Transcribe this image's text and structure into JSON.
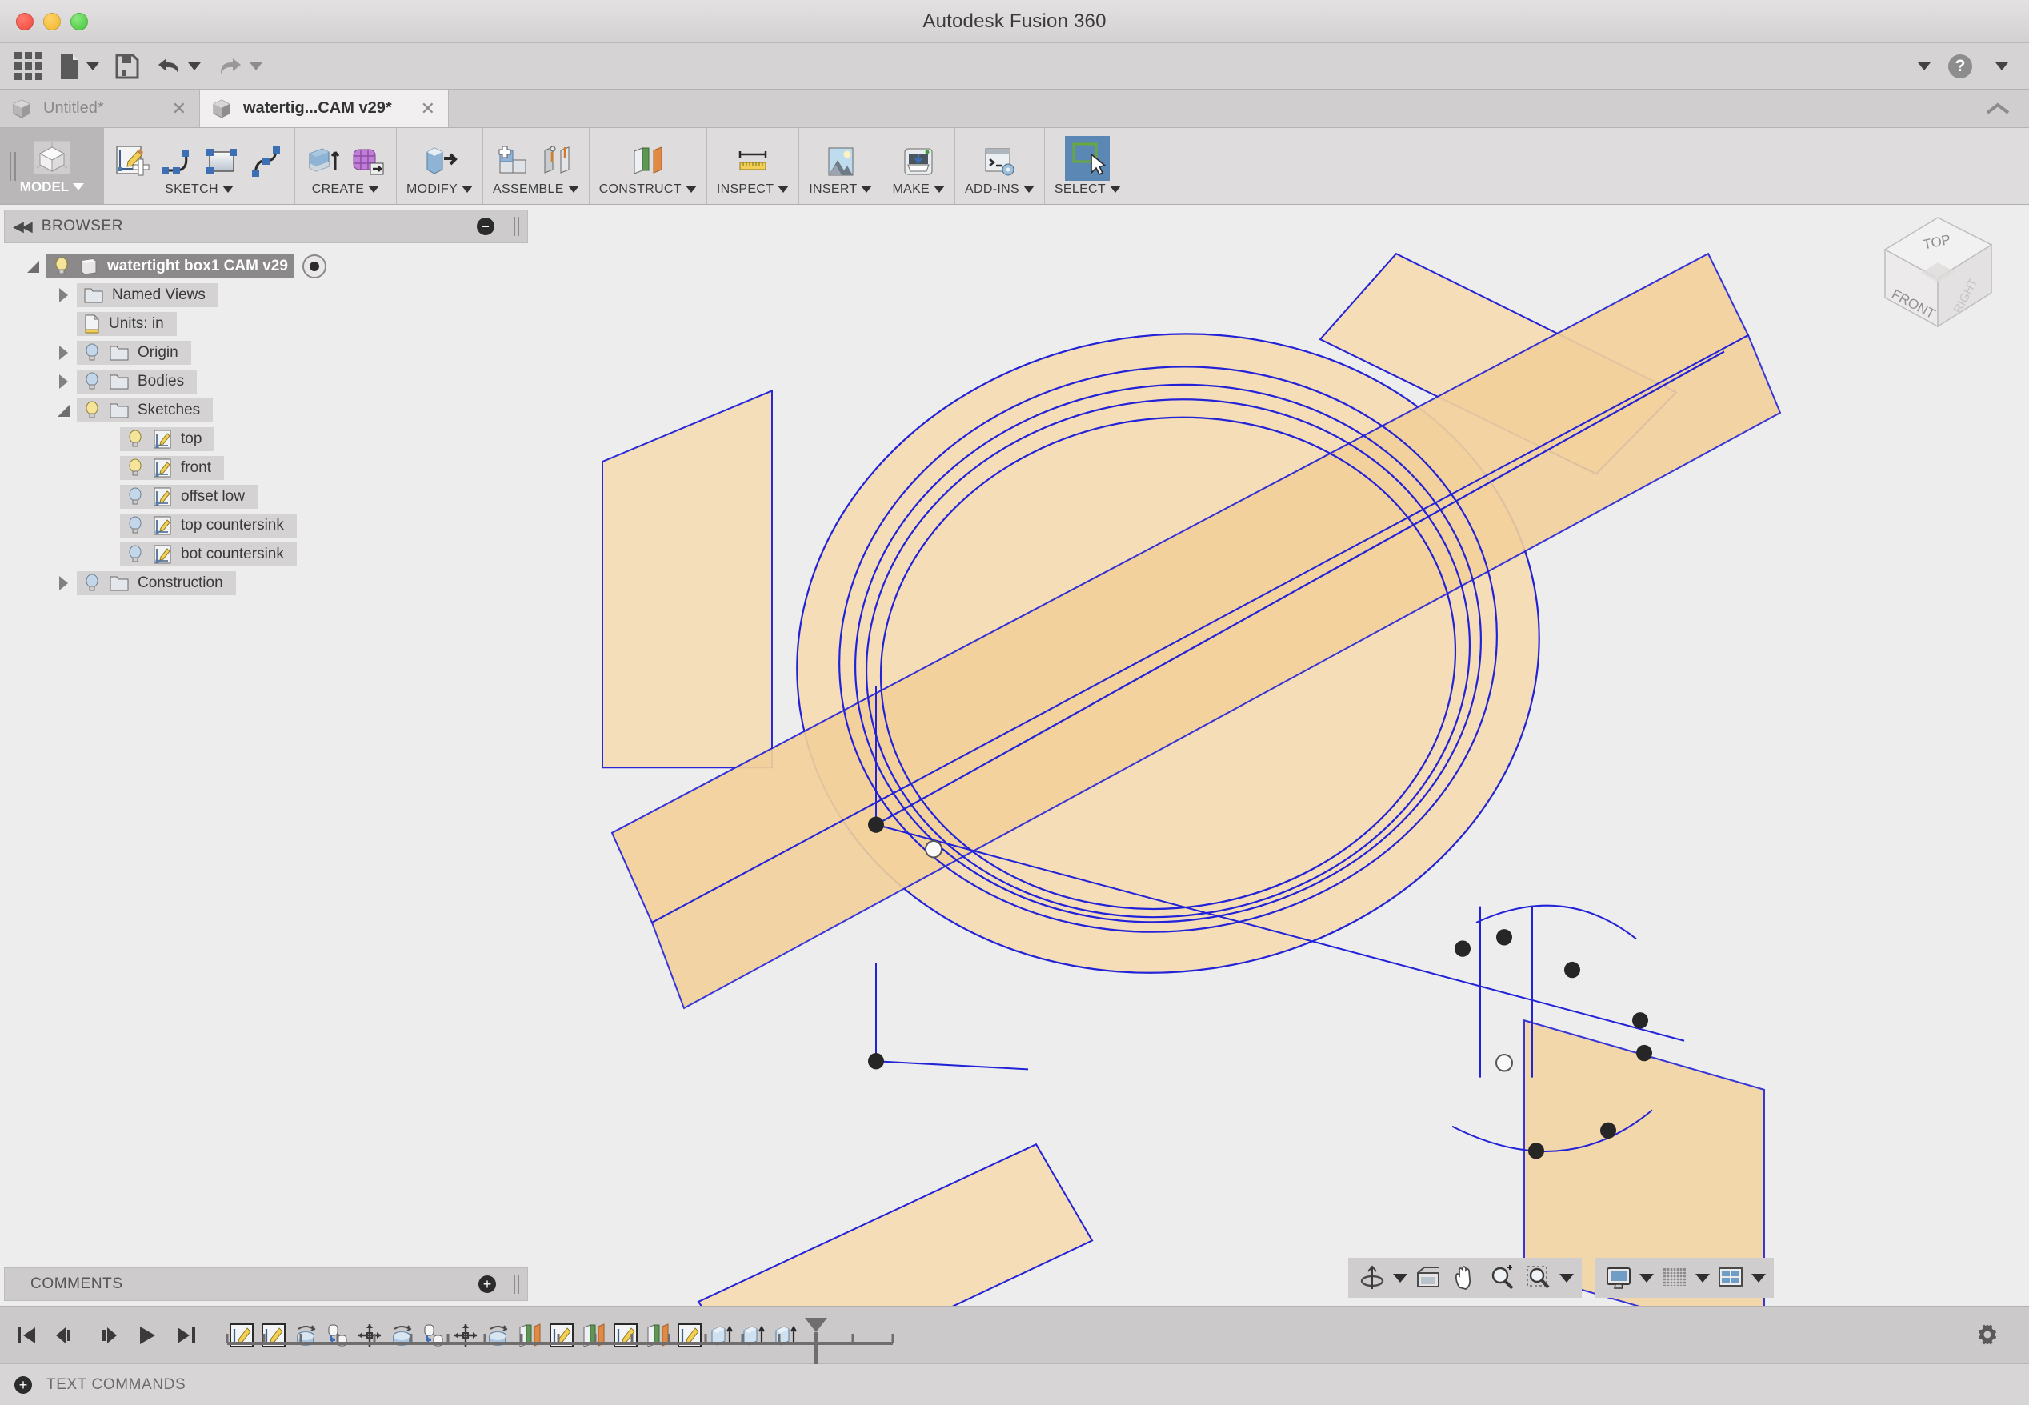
{
  "window": {
    "title": "Autodesk Fusion 360",
    "traffic_lights": [
      "close",
      "minimize",
      "maximize"
    ]
  },
  "quick_access": {
    "items": [
      {
        "name": "app-grid",
        "icon": "grid-icon",
        "has_caret": false
      },
      {
        "name": "new-file",
        "icon": "file-icon",
        "has_caret": true
      },
      {
        "name": "save",
        "icon": "save-icon",
        "has_caret": false
      },
      {
        "name": "undo",
        "icon": "undo-icon",
        "has_caret": true
      },
      {
        "name": "redo",
        "icon": "redo-icon",
        "has_caret": true
      }
    ],
    "right": [
      {
        "name": "account-menu",
        "icon": "chevron-down-icon"
      },
      {
        "name": "help",
        "icon": "help-icon"
      },
      {
        "name": "help-menu",
        "icon": "chevron-down-icon"
      }
    ]
  },
  "document_tabs": [
    {
      "label": "Untitled*",
      "active": false,
      "closable": true
    },
    {
      "label": "watertig...CAM v29*",
      "active": true,
      "closable": true
    }
  ],
  "tabbar_collapse_icon": "chevron-up-icon",
  "ribbon": {
    "workspace": {
      "label": "MODEL",
      "icon": "model-cube-icon",
      "has_caret": true
    },
    "panels": [
      {
        "label": "SKETCH",
        "has_caret": true,
        "icons": [
          "create-sketch-icon",
          "arc-icon",
          "rectangle-icon",
          "spline-icon"
        ]
      },
      {
        "label": "CREATE",
        "has_caret": true,
        "icons": [
          "extrude-icon",
          "create-form-icon"
        ]
      },
      {
        "label": "MODIFY",
        "has_caret": true,
        "icons": [
          "press-pull-icon"
        ]
      },
      {
        "label": "ASSEMBLE",
        "has_caret": true,
        "icons": [
          "new-component-icon",
          "joint-icon"
        ]
      },
      {
        "label": "CONSTRUCT",
        "has_caret": true,
        "icons": [
          "offset-plane-icon"
        ]
      },
      {
        "label": "INSPECT",
        "has_caret": true,
        "icons": [
          "measure-icon"
        ]
      },
      {
        "label": "INSERT",
        "has_caret": true,
        "icons": [
          "insert-image-icon"
        ]
      },
      {
        "label": "MAKE",
        "has_caret": true,
        "icons": [
          "3d-print-icon"
        ]
      },
      {
        "label": "ADD-INS",
        "has_caret": true,
        "icons": [
          "scripts-addins-icon"
        ]
      },
      {
        "label": "SELECT",
        "has_caret": true,
        "icons": [
          "select-cursor-icon"
        ],
        "selected": true
      }
    ]
  },
  "browser": {
    "title": "BROWSER",
    "collapse_icon": "double-left-arrow-icon",
    "minimize_icon": "minus-circle-icon",
    "grip_icon": "vertical-grip-icon",
    "tree": [
      {
        "label": "watertight box1 CAM v29",
        "depth": 0,
        "twisty": "open",
        "root": true,
        "bulb": "on",
        "icon": "component-icon",
        "radio": true
      },
      {
        "label": "Named Views",
        "depth": 1,
        "twisty": "closed",
        "bulb": "none",
        "icon": "folder-icon"
      },
      {
        "label": "Units: in",
        "depth": 1,
        "twisty": "none",
        "bulb": "none",
        "icon": "units-doc-icon"
      },
      {
        "label": "Origin",
        "depth": 1,
        "twisty": "closed",
        "bulb": "off",
        "icon": "folder-icon"
      },
      {
        "label": "Bodies",
        "depth": 1,
        "twisty": "closed",
        "bulb": "off",
        "icon": "folder-icon"
      },
      {
        "label": "Sketches",
        "depth": 1,
        "twisty": "open",
        "bulb": "on",
        "icon": "folder-icon"
      },
      {
        "label": "top",
        "depth": 2,
        "twisty": "none",
        "bulb": "on",
        "icon": "sketch-icon"
      },
      {
        "label": "front",
        "depth": 2,
        "twisty": "none",
        "bulb": "on",
        "icon": "sketch-icon"
      },
      {
        "label": "offset low",
        "depth": 2,
        "twisty": "none",
        "bulb": "off",
        "icon": "sketch-icon"
      },
      {
        "label": "top countersink",
        "depth": 2,
        "twisty": "none",
        "bulb": "off",
        "icon": "sketch-icon"
      },
      {
        "label": "bot countersink",
        "depth": 2,
        "twisty": "none",
        "bulb": "off",
        "icon": "sketch-icon"
      },
      {
        "label": "Construction",
        "depth": 1,
        "twisty": "closed",
        "bulb": "off",
        "icon": "folder-icon"
      }
    ]
  },
  "comments": {
    "title": "COMMENTS",
    "add_icon": "plus-circle-icon",
    "grip_icon": "vertical-grip-icon"
  },
  "viewcube": {
    "faces": [
      "TOP",
      "FRONT",
      "RIGHT"
    ],
    "top_label": "TOP",
    "front_label": "FRONT",
    "right_label": "RIGHT"
  },
  "navigation_bar": {
    "group1": [
      {
        "name": "orbit-icon",
        "caret": true
      },
      {
        "name": "look-at-icon",
        "caret": false
      },
      {
        "name": "pan-icon",
        "caret": false
      },
      {
        "name": "zoom-icon",
        "caret": false
      },
      {
        "name": "zoom-window-icon",
        "caret": true
      }
    ],
    "group2": [
      {
        "name": "display-settings-icon",
        "caret": true
      },
      {
        "name": "grid-snap-icon",
        "caret": true
      },
      {
        "name": "viewports-icon",
        "caret": true
      }
    ]
  },
  "timeline": {
    "playback": [
      "go-to-beginning-icon",
      "step-back-icon",
      "step-forward-icon",
      "play-icon",
      "go-to-end-icon"
    ],
    "items": [
      {
        "name": "sketch-icon",
        "label": "Sketch1"
      },
      {
        "name": "sketch-icon",
        "label": "Sketch2"
      },
      {
        "name": "revolve-icon",
        "label": "Revolve1"
      },
      {
        "name": "joint-icon",
        "label": "Joint1"
      },
      {
        "name": "move-icon",
        "label": "Move1"
      },
      {
        "name": "revolve-icon",
        "label": "Revolve2"
      },
      {
        "name": "joint-icon",
        "label": "Joint2"
      },
      {
        "name": "move-icon",
        "label": "Move2"
      },
      {
        "name": "revolve-icon",
        "label": "Revolve3"
      },
      {
        "name": "construction-plane-icon",
        "label": "Plane1"
      },
      {
        "name": "sketch-icon",
        "label": "Sketch3"
      },
      {
        "name": "construction-plane-icon",
        "label": "Plane2"
      },
      {
        "name": "sketch-icon",
        "label": "Sketch4"
      },
      {
        "name": "construction-plane-icon",
        "label": "Plane3"
      },
      {
        "name": "sketch-icon",
        "label": "Sketch5"
      },
      {
        "name": "extrude-icon",
        "label": "Extrude1"
      },
      {
        "name": "extrude-icon",
        "label": "Extrude2"
      },
      {
        "name": "extrude-icon",
        "label": "Extrude3"
      }
    ],
    "marker_position_index": 18,
    "settings_icon": "gear-icon"
  },
  "status_bar": {
    "label": "TEXT COMMANDS",
    "add_icon": "plus-circle-icon"
  },
  "colors": {
    "accent_selected": "#5b87b5",
    "sketch_line": "#2222d8",
    "body_fill": "#f3dcb6",
    "body_fill_dark": "#f2cf95",
    "canvas_bg": "#ededed",
    "chrome_bg": "#d5d3d3"
  },
  "model": {
    "description": "Isometric view of a circular watertight box lid with sketch planes and construction geometry"
  }
}
